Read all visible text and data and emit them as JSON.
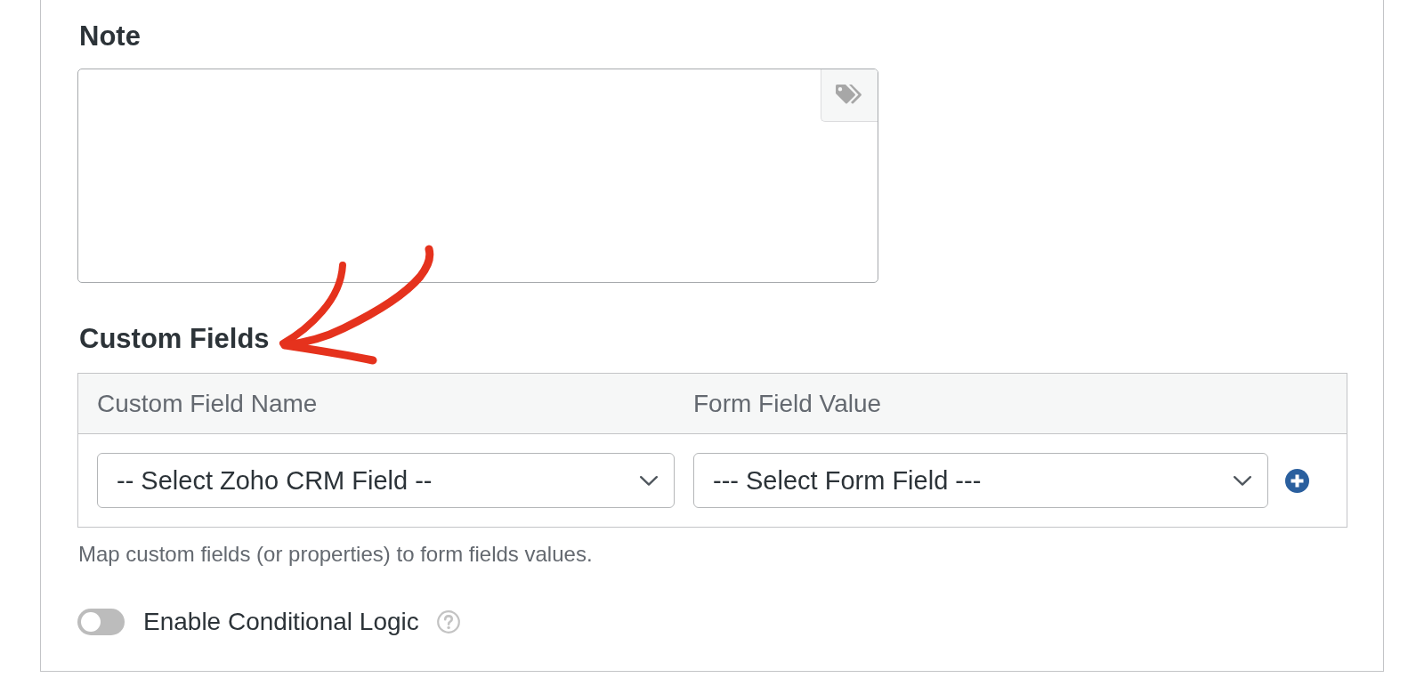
{
  "note": {
    "label": "Note"
  },
  "custom_fields": {
    "heading": "Custom Fields",
    "table": {
      "columns": [
        "Custom Field Name",
        "Form Field Value"
      ],
      "rows": [
        {
          "cells": [
            "-- Select Zoho CRM Field --",
            "--- Select Form Field ---"
          ]
        }
      ]
    },
    "help_text": "Map custom fields (or properties) to form fields values."
  },
  "conditional_logic": {
    "label": "Enable Conditional Logic",
    "on": false
  }
}
